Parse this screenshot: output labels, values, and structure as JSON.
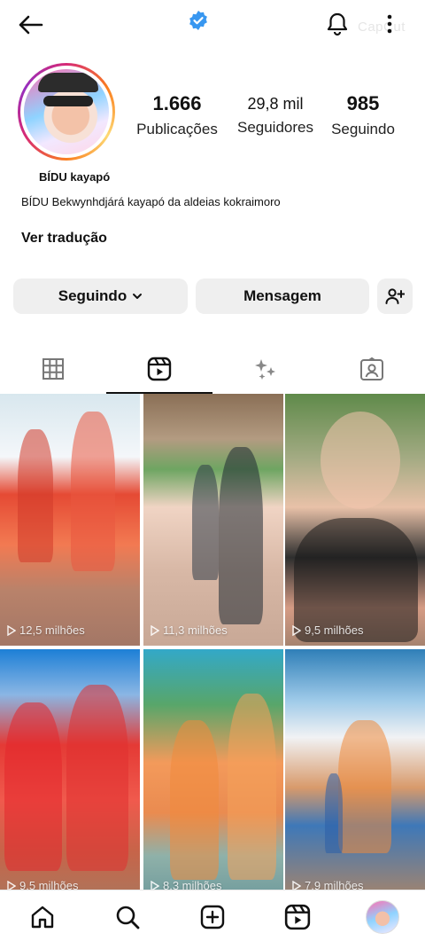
{
  "header": {
    "back_icon": "arrow-left-icon",
    "verified_icon": "verified-badge-icon",
    "verified_color": "#3897f0",
    "notifications_icon": "bell-icon",
    "watermark": "CapCut",
    "more_icon": "more-vertical-icon"
  },
  "profile": {
    "name": "BÍDU kayapó",
    "bio": "BÍDU Bekwynhdjárá kayapó da aldeias kokraimoro",
    "translate_link": "Ver tradução",
    "stats": [
      {
        "value": "1.666",
        "label": "Publicações"
      },
      {
        "value": "29,8 mil",
        "label": "Seguidores"
      },
      {
        "value": "985",
        "label": "Seguindo"
      }
    ]
  },
  "actions": {
    "following_label": "Seguindo",
    "message_label": "Mensagem",
    "add_user_icon": "add-user-icon"
  },
  "tabs": [
    {
      "icon": "grid-icon",
      "active": false
    },
    {
      "icon": "reels-icon",
      "active": true
    },
    {
      "icon": "sparkles-icon",
      "active": false
    },
    {
      "icon": "tagged-icon",
      "active": false
    }
  ],
  "reels": [
    {
      "views": "12,5 milhões"
    },
    {
      "views": "11,3 milhões"
    },
    {
      "views": "9,5 milhões"
    },
    {
      "views": "9,5 milhões"
    },
    {
      "views": "8,3 milhões"
    },
    {
      "views": "7,9 milhões"
    }
  ],
  "bottom_nav": [
    {
      "icon": "home-icon"
    },
    {
      "icon": "search-icon"
    },
    {
      "icon": "create-icon"
    },
    {
      "icon": "reels-icon"
    },
    {
      "icon": "profile-avatar"
    }
  ]
}
